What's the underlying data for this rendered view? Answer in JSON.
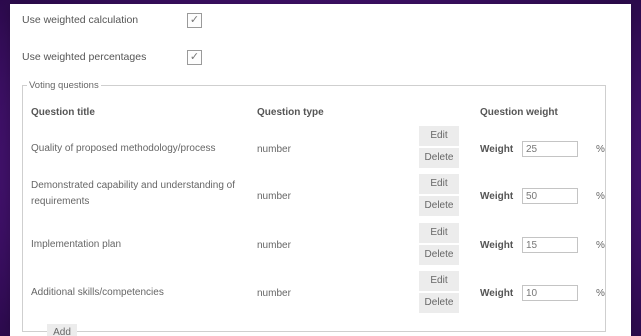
{
  "options": [
    {
      "label": "Use weighted calculation",
      "checked": true
    },
    {
      "label": "Use weighted percentages",
      "checked": true
    }
  ],
  "voting": {
    "legend": "Voting questions",
    "headers": {
      "title": "Question title",
      "type": "Question type",
      "weight": "Question weight"
    },
    "edit_label": "Edit",
    "delete_label": "Delete",
    "weight_label": "Weight",
    "percent_symbol": "%",
    "questions": [
      {
        "title": "Quality of proposed methodology/process",
        "type": "number",
        "weight": "25"
      },
      {
        "title": "Demonstrated capability and understanding of requirements",
        "type": "number",
        "weight": "50"
      },
      {
        "title": "Implementation plan",
        "type": "number",
        "weight": "15"
      },
      {
        "title": "Additional skills/competencies",
        "type": "number",
        "weight": "10"
      }
    ],
    "add_label": "Add"
  }
}
